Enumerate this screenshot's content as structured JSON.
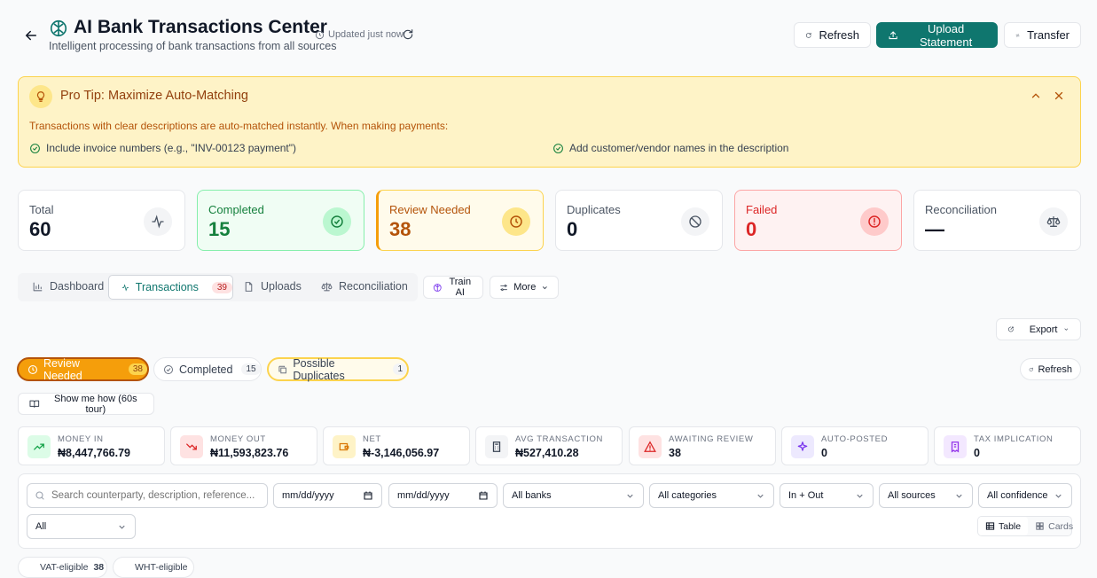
{
  "header": {
    "title": "AI Bank Transactions Center",
    "subtitle": "Intelligent processing of bank transactions from all sources",
    "updated": "Updated just now",
    "refresh_label": "Refresh",
    "upload_label": "Upload Statement",
    "transfer_label": "Transfer"
  },
  "tip": {
    "title": "Pro Tip: Maximize Auto-Matching",
    "body": "Transactions with clear descriptions are auto-matched instantly. When making payments:",
    "item1": "Include invoice numbers (e.g., \"INV-00123 payment\")",
    "item2": "Add customer/vendor names in the description"
  },
  "stats": [
    {
      "label": "Total",
      "value": "60"
    },
    {
      "label": "Completed",
      "value": "15"
    },
    {
      "label": "Review Needed",
      "value": "38"
    },
    {
      "label": "Duplicates",
      "value": "0"
    },
    {
      "label": "Failed",
      "value": "0"
    },
    {
      "label": "Reconciliation",
      "value": "—"
    }
  ],
  "tabs": {
    "dashboard": "Dashboard",
    "transactions": "Transactions",
    "transactions_count": "39",
    "uploads": "Uploads",
    "reconciliation": "Reconciliation",
    "train_ai": "Train AI",
    "more": "More"
  },
  "export_label": "Export",
  "filters": {
    "review_needed": "Review Needed",
    "review_needed_count": "38",
    "completed": "Completed",
    "completed_count": "15",
    "possible_duplicates": "Possible Duplicates",
    "possible_duplicates_count": "1",
    "refresh": "Refresh"
  },
  "tour_label": "Show me how (60s tour)",
  "metrics": [
    {
      "label": "Money In",
      "value": "₦8,447,766.79"
    },
    {
      "label": "Money Out",
      "value": "₦11,593,823.76"
    },
    {
      "label": "Net",
      "value": "₦-3,146,056.97"
    },
    {
      "label": "Avg Transaction",
      "value": "₦527,410.28"
    },
    {
      "label": "Awaiting Review",
      "value": "38"
    },
    {
      "label": "Auto-Posted",
      "value": "0"
    },
    {
      "label": "Tax Implication",
      "value": "0"
    }
  ],
  "search": {
    "placeholder": "Search counterparty, description, reference..."
  },
  "date_placeholder": "mm/dd/yyyy",
  "selects": {
    "banks": "All banks",
    "categories": "All categories",
    "direction": "In + Out",
    "sources": "All sources",
    "confidence": "All confidence",
    "status": "All"
  },
  "view": {
    "table": "Table",
    "cards": "Cards"
  },
  "chips": [
    {
      "label": "VAT-eligible",
      "count": "38"
    },
    {
      "label": "WHT-eligible",
      "count": ""
    }
  ],
  "colors": {
    "primary": "#0f766e",
    "warning": "#d97706",
    "danger": "#dc2626",
    "success": "#16a34a"
  }
}
